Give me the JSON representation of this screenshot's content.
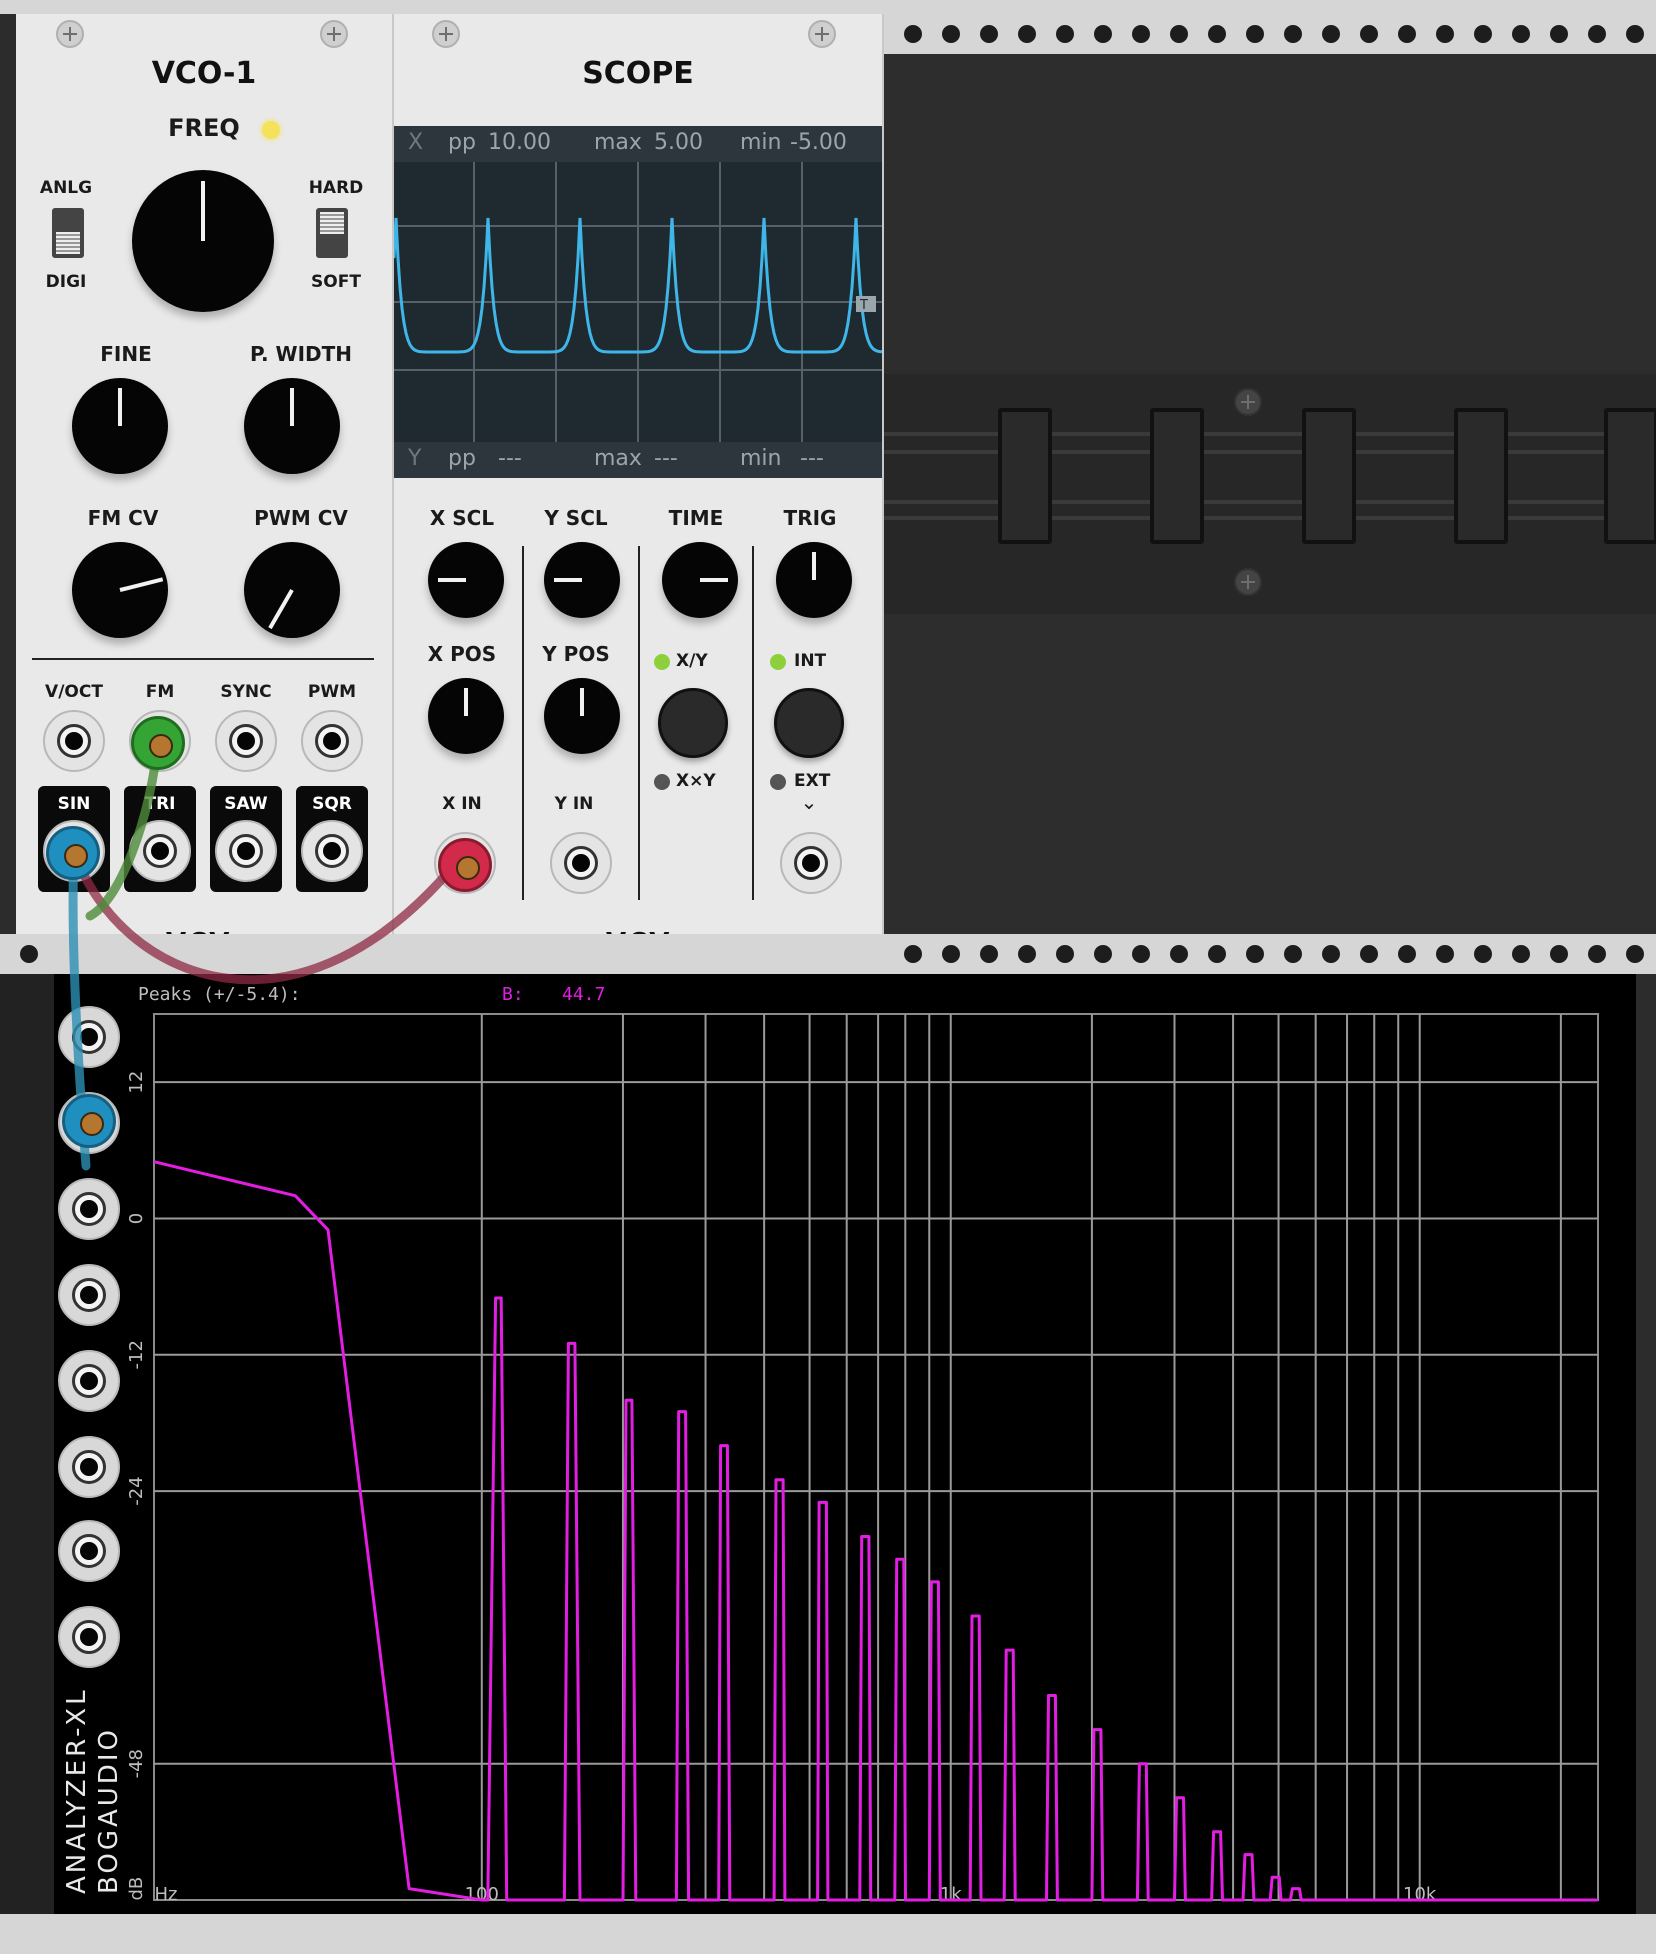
{
  "vco": {
    "title": "VCO-1",
    "freq_label": "FREQ",
    "anlg_label": "ANLG",
    "digi_label": "DIGI",
    "hard_label": "HARD",
    "soft_label": "SOFT",
    "fine_label": "FINE",
    "pwidth_label": "P. WIDTH",
    "fmcv_label": "FM CV",
    "pwmcv_label": "PWM CV",
    "inputs": [
      "V/OCT",
      "FM",
      "SYNC",
      "PWM"
    ],
    "outputs": [
      "SIN",
      "TRI",
      "SAW",
      "SQR"
    ],
    "brand": "VCV"
  },
  "scope": {
    "title": "SCOPE",
    "x_stats": {
      "channel": "X",
      "pp_label": "pp",
      "pp": "10.00",
      "max_label": "max",
      "max": "5.00",
      "min_label": "min",
      "min": "-5.00"
    },
    "y_stats": {
      "channel": "Y",
      "pp_label": "pp",
      "pp": "---",
      "max_label": "max",
      "max": "---",
      "min_label": "min",
      "min": "---"
    },
    "trigger_marker": "T",
    "controls": {
      "x_scl": "X SCL",
      "y_scl": "Y SCL",
      "time": "TIME",
      "trig": "TRIG",
      "x_pos": "X POS",
      "y_pos": "Y POS",
      "xy": "X/Y",
      "xmy": "X×Y",
      "int": "INT",
      "ext": "EXT",
      "x_in": "X IN",
      "y_in": "Y IN",
      "chevron": "⌄"
    },
    "brand": "VCV"
  },
  "analyzer": {
    "name": "ANALYZER-XL",
    "maker": "BOGAUDIO",
    "peaks_label": "Peaks (+/-5.4):",
    "channel_b": "B:",
    "peak_value": "44.7",
    "accent_color": "#e31ee3",
    "y_ticks": [
      "12",
      "0",
      "-12",
      "-24",
      "-48",
      "dB"
    ],
    "x_ticks": [
      "Hz",
      "100",
      "1k",
      "10k"
    ]
  },
  "chart_data": {
    "type": "line",
    "title": "",
    "xlabel": "Hz",
    "ylabel": "dB",
    "x_scale": "log",
    "xlim": [
      20,
      24000
    ],
    "ylim": [
      -60,
      18
    ],
    "series": [
      {
        "color": "#e31ee3",
        "x": [
          20,
          40,
          47,
          70,
          100,
          103,
          107,
          110,
          113,
          150,
          153,
          158,
          162,
          200,
          203,
          209,
          213,
          260,
          263,
          272,
          276,
          320,
          323,
          334,
          338,
          420,
          424,
          439,
          443,
          520,
          524,
          543,
          547,
          640,
          646,
          669,
          675,
          760,
          767,
          794,
          801,
          900,
          909,
          941,
          950,
          1100,
          1110,
          1150,
          1160,
          1300,
          1313,
          1359,
          1372,
          1600,
          1616,
          1672,
          1688,
          2000,
          2020,
          2090,
          2110,
          2500,
          2525,
          2612,
          2637,
          3000,
          3030,
          3135,
          3165,
          3600,
          3636,
          3762,
          3798,
          4200,
          4242,
          4389,
          4431,
          4800,
          4848,
          5016,
          5064,
          5300,
          5353,
          5539,
          5591,
          24000
        ],
        "y": [
          5,
          2,
          -1,
          -59,
          -60,
          -60,
          -7,
          -7,
          -60,
          -60,
          -11,
          -11,
          -60,
          -60,
          -16,
          -16,
          -60,
          -60,
          -17,
          -17,
          -60,
          -60,
          -20,
          -20,
          -60,
          -60,
          -23,
          -23,
          -60,
          -60,
          -25,
          -25,
          -60,
          -60,
          -28,
          -28,
          -60,
          -60,
          -30,
          -30,
          -60,
          -60,
          -32,
          -32,
          -60,
          -60,
          -35,
          -35,
          -60,
          -60,
          -38,
          -38,
          -60,
          -60,
          -42,
          -42,
          -60,
          -60,
          -45,
          -45,
          -60,
          -60,
          -48,
          -48,
          -60,
          -60,
          -51,
          -51,
          -60,
          -60,
          -54,
          -54,
          -60,
          -60,
          -56,
          -56,
          -60,
          -60,
          -58,
          -58,
          -60,
          -60,
          -59,
          -59,
          -60,
          -60
        ]
      }
    ]
  }
}
